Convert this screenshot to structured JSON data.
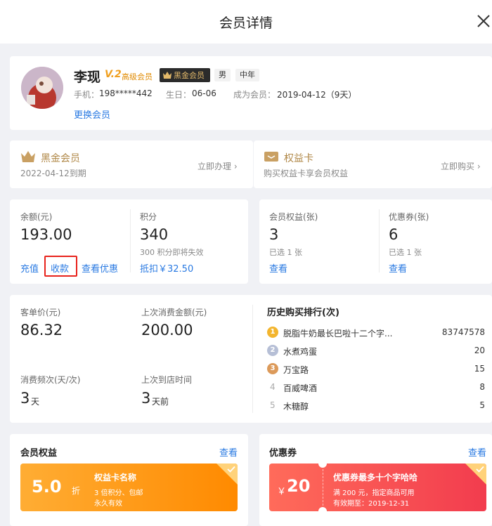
{
  "header": {
    "title": "会员详情"
  },
  "member": {
    "name": "李现",
    "level_badge": "V.2",
    "level_name": "高级会员",
    "black_badge": "黑金会员",
    "gender": "男",
    "age_group": "中年",
    "phone_label": "手机：",
    "phone": "198*****442",
    "birthday_label": "生日：",
    "birthday": "06-06",
    "join_label": "成为会员：",
    "join_date": "2019-04-12（9天）",
    "switch_label": "更换会员"
  },
  "black_card": {
    "title": "黑金会员",
    "expiry": "2022-04-12到期",
    "action": "立即办理 ›"
  },
  "rights_card": {
    "title": "权益卡",
    "desc": "购买权益卡享会员权益",
    "action": "立即购买 ›"
  },
  "balance": {
    "label": "余额(元)",
    "value": "193.00",
    "recharge": "充值",
    "collect": "收款",
    "view_discount": "查看优惠"
  },
  "points": {
    "label": "积分",
    "value": "340",
    "expire_note": "300 积分即将失效",
    "deduct": "抵扣￥32.50"
  },
  "member_rights": {
    "label": "会员权益(张)",
    "value": "3",
    "selected": "已选 1 张",
    "view": "查看"
  },
  "coupons_stat": {
    "label": "优惠券(张)",
    "value": "6",
    "selected": "已选 1 张",
    "view": "查看"
  },
  "stats": {
    "avg_price_label": "客单价(元)",
    "avg_price": "86.32",
    "last_amount_label": "上次消费金额(元)",
    "last_amount": "200.00",
    "frequency_label": "消费频次(天/次)",
    "frequency_value": "3",
    "frequency_unit": "天",
    "last_visit_label": "上次到店时间",
    "last_visit_value": "3",
    "last_visit_unit": "天前"
  },
  "ranking": {
    "title": "历史购买排行(次)",
    "items": [
      {
        "rank": "1",
        "name": "脱脂牛奶最长巴啦十二个字...",
        "count": "83747578"
      },
      {
        "rank": "2",
        "name": "水煮鸡蛋",
        "count": "20"
      },
      {
        "rank": "3",
        "name": "万宝路",
        "count": "15"
      },
      {
        "rank": "4",
        "name": "百威啤酒",
        "count": "8"
      },
      {
        "rank": "5",
        "name": "木糖醇",
        "count": "5"
      }
    ]
  },
  "rights_section": {
    "title": "会员权益",
    "view": "查看",
    "card": {
      "discount": "5.0",
      "discount_unit": "折",
      "name": "权益卡名称",
      "desc": "3 倍积分、包邮",
      "validity": "永久有效"
    }
  },
  "coupon_section": {
    "title": "优惠券",
    "view": "查看",
    "card": {
      "currency": "￥",
      "amount": "20",
      "name": "优惠券最多十个字哈哈",
      "condition": "满 200 元，指定商品可用",
      "validity": "有效期至：2019-12-31"
    }
  },
  "colors": {
    "accent_blue": "#2a7ae2",
    "gold": "#c9a063",
    "orange": "#ff8a00",
    "red": "#f23c4e"
  }
}
